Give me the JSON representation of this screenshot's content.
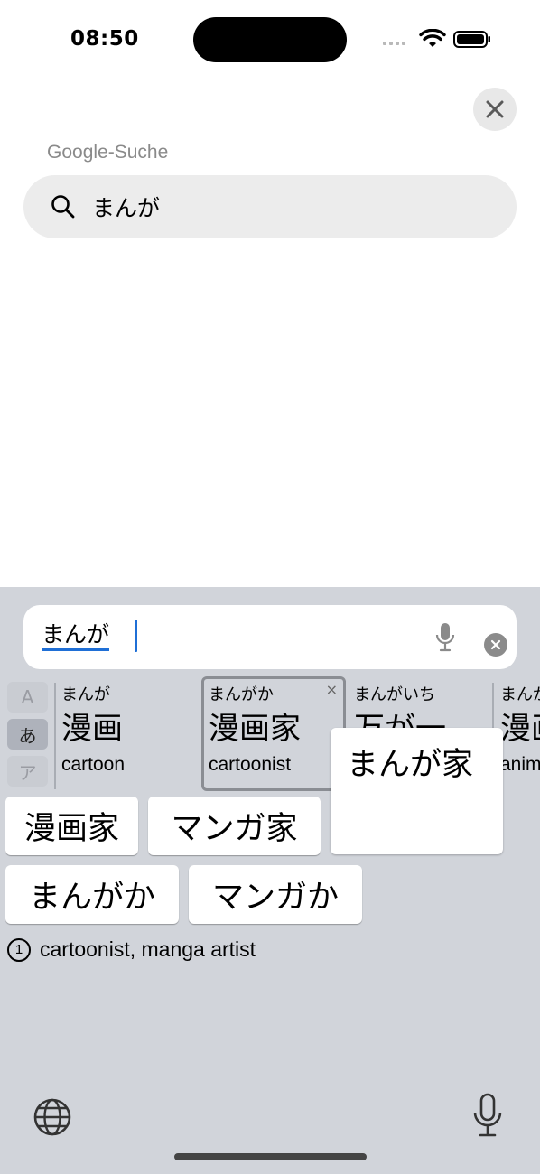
{
  "status": {
    "time": "08:50"
  },
  "search": {
    "title": "Google-Suche",
    "query": "まんが"
  },
  "keyboard": {
    "input_text": "まんが",
    "script_tabs": [
      "A",
      "あ",
      "ア"
    ],
    "candidates": [
      {
        "reading": "まんが",
        "kanji": "漫画",
        "english": "cartoon"
      },
      {
        "reading": "まんがか",
        "kanji": "漫画家",
        "english": "cartoonist",
        "remove": "×"
      },
      {
        "reading": "まんがいち",
        "kanji": "万が一",
        "english": ""
      },
      {
        "reading": "まんが",
        "kanji": "漫画",
        "english": "anim"
      }
    ],
    "popup": "まんが家",
    "conversions_row1": [
      "漫画家",
      "マンガ家"
    ],
    "conversions_row2": [
      "まんがか",
      "マンガか"
    ],
    "definition_number": "1",
    "definition": "cartoonist, manga artist"
  },
  "colors": {
    "accent": "#1f6fd6",
    "keyboard_bg": "#d1d4da"
  }
}
